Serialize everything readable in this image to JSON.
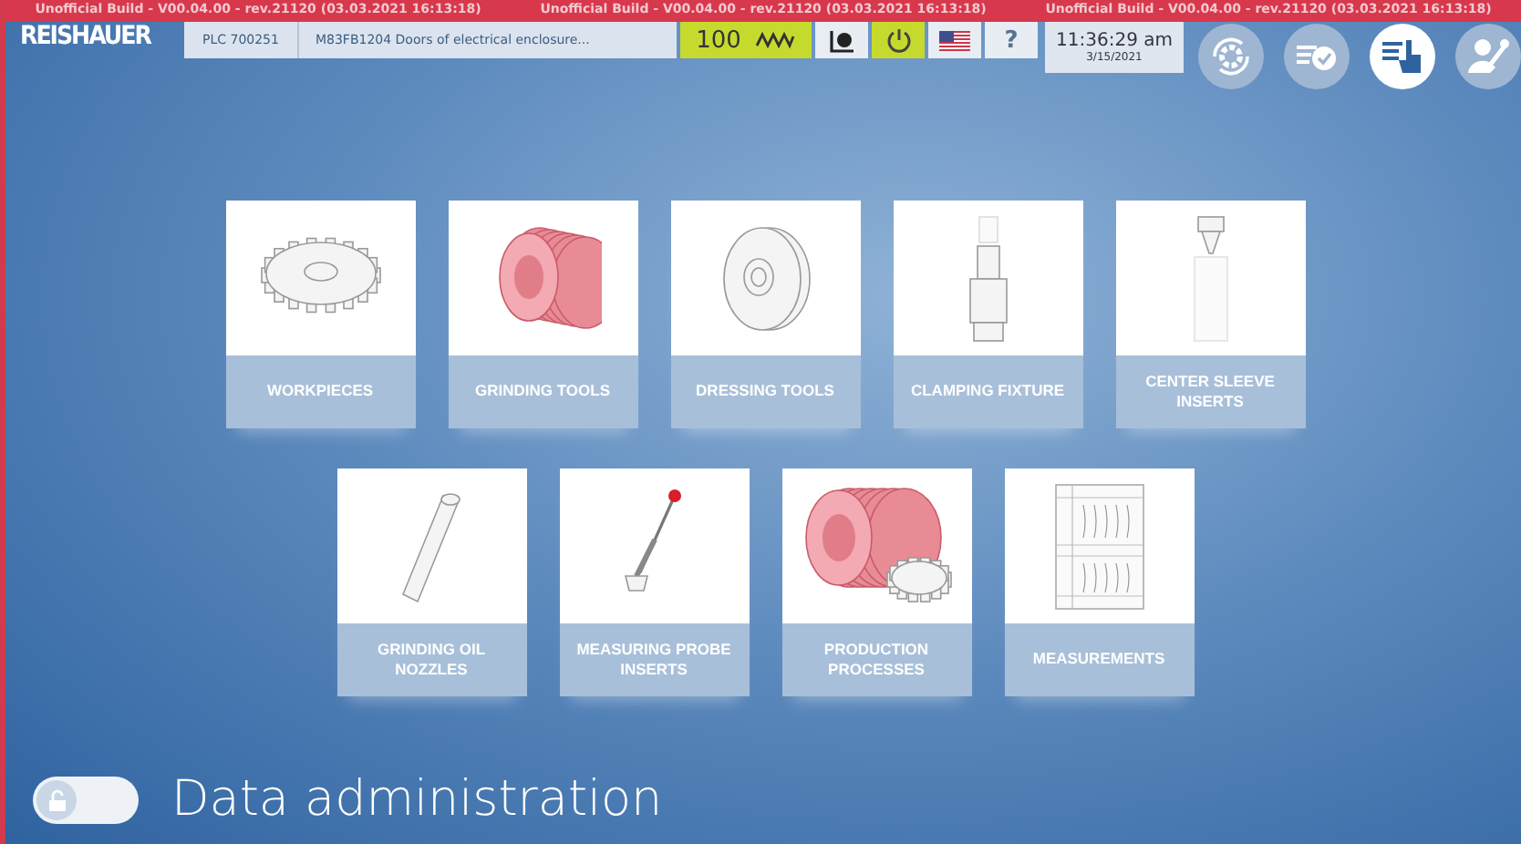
{
  "build_banner": [
    "Unofficial Build - V00.04.00 - rev.21120 (03.03.2021 16:13:18)",
    "Unofficial Build - V00.04.00 - rev.21120 (03.03.2021 16:13:18)",
    "Unofficial Build - V00.04.00 - rev.21120 (03.03.2021 16:13:18)"
  ],
  "logo": "REISHAUER",
  "plc": {
    "label": "PLC 700251",
    "message": "M83FB1204 Doors of electrical enclosure..."
  },
  "status": [
    {
      "kind": "feed",
      "text": "100",
      "active": true
    },
    {
      "kind": "camera",
      "active": false
    },
    {
      "kind": "power",
      "active": true
    },
    {
      "kind": "flag",
      "active": false
    },
    {
      "kind": "help",
      "text": "?",
      "active": false
    }
  ],
  "clock": {
    "time": "11:36:29 am",
    "date": "3/15/2021"
  },
  "nav": [
    {
      "kind": "gear-cycle",
      "selected": false
    },
    {
      "kind": "list-check",
      "selected": false
    },
    {
      "kind": "list-hand",
      "selected": true
    },
    {
      "kind": "user-wrench",
      "selected": false
    }
  ],
  "tile_rows": [
    [
      {
        "kind": "gear",
        "label": "WORKPIECES"
      },
      {
        "kind": "worm",
        "label": "GRINDING TOOLS"
      },
      {
        "kind": "disc",
        "label": "DRESSING TOOLS"
      },
      {
        "kind": "fixture",
        "label": "CLAMPING FIXTURE"
      },
      {
        "kind": "sleeve",
        "label": "CENTER SLEEVE INSERTS"
      }
    ],
    [
      {
        "kind": "nozzle",
        "label": "GRINDING OIL NOZZLES"
      },
      {
        "kind": "probe",
        "label": "MEASURING PROBE INSERTS"
      },
      {
        "kind": "worm-gear",
        "label": "PRODUCTION PROCESSES"
      },
      {
        "kind": "sheet",
        "label": "MEASUREMENTS"
      }
    ]
  ],
  "footer": {
    "lock_on": false,
    "title": "Data administration"
  }
}
